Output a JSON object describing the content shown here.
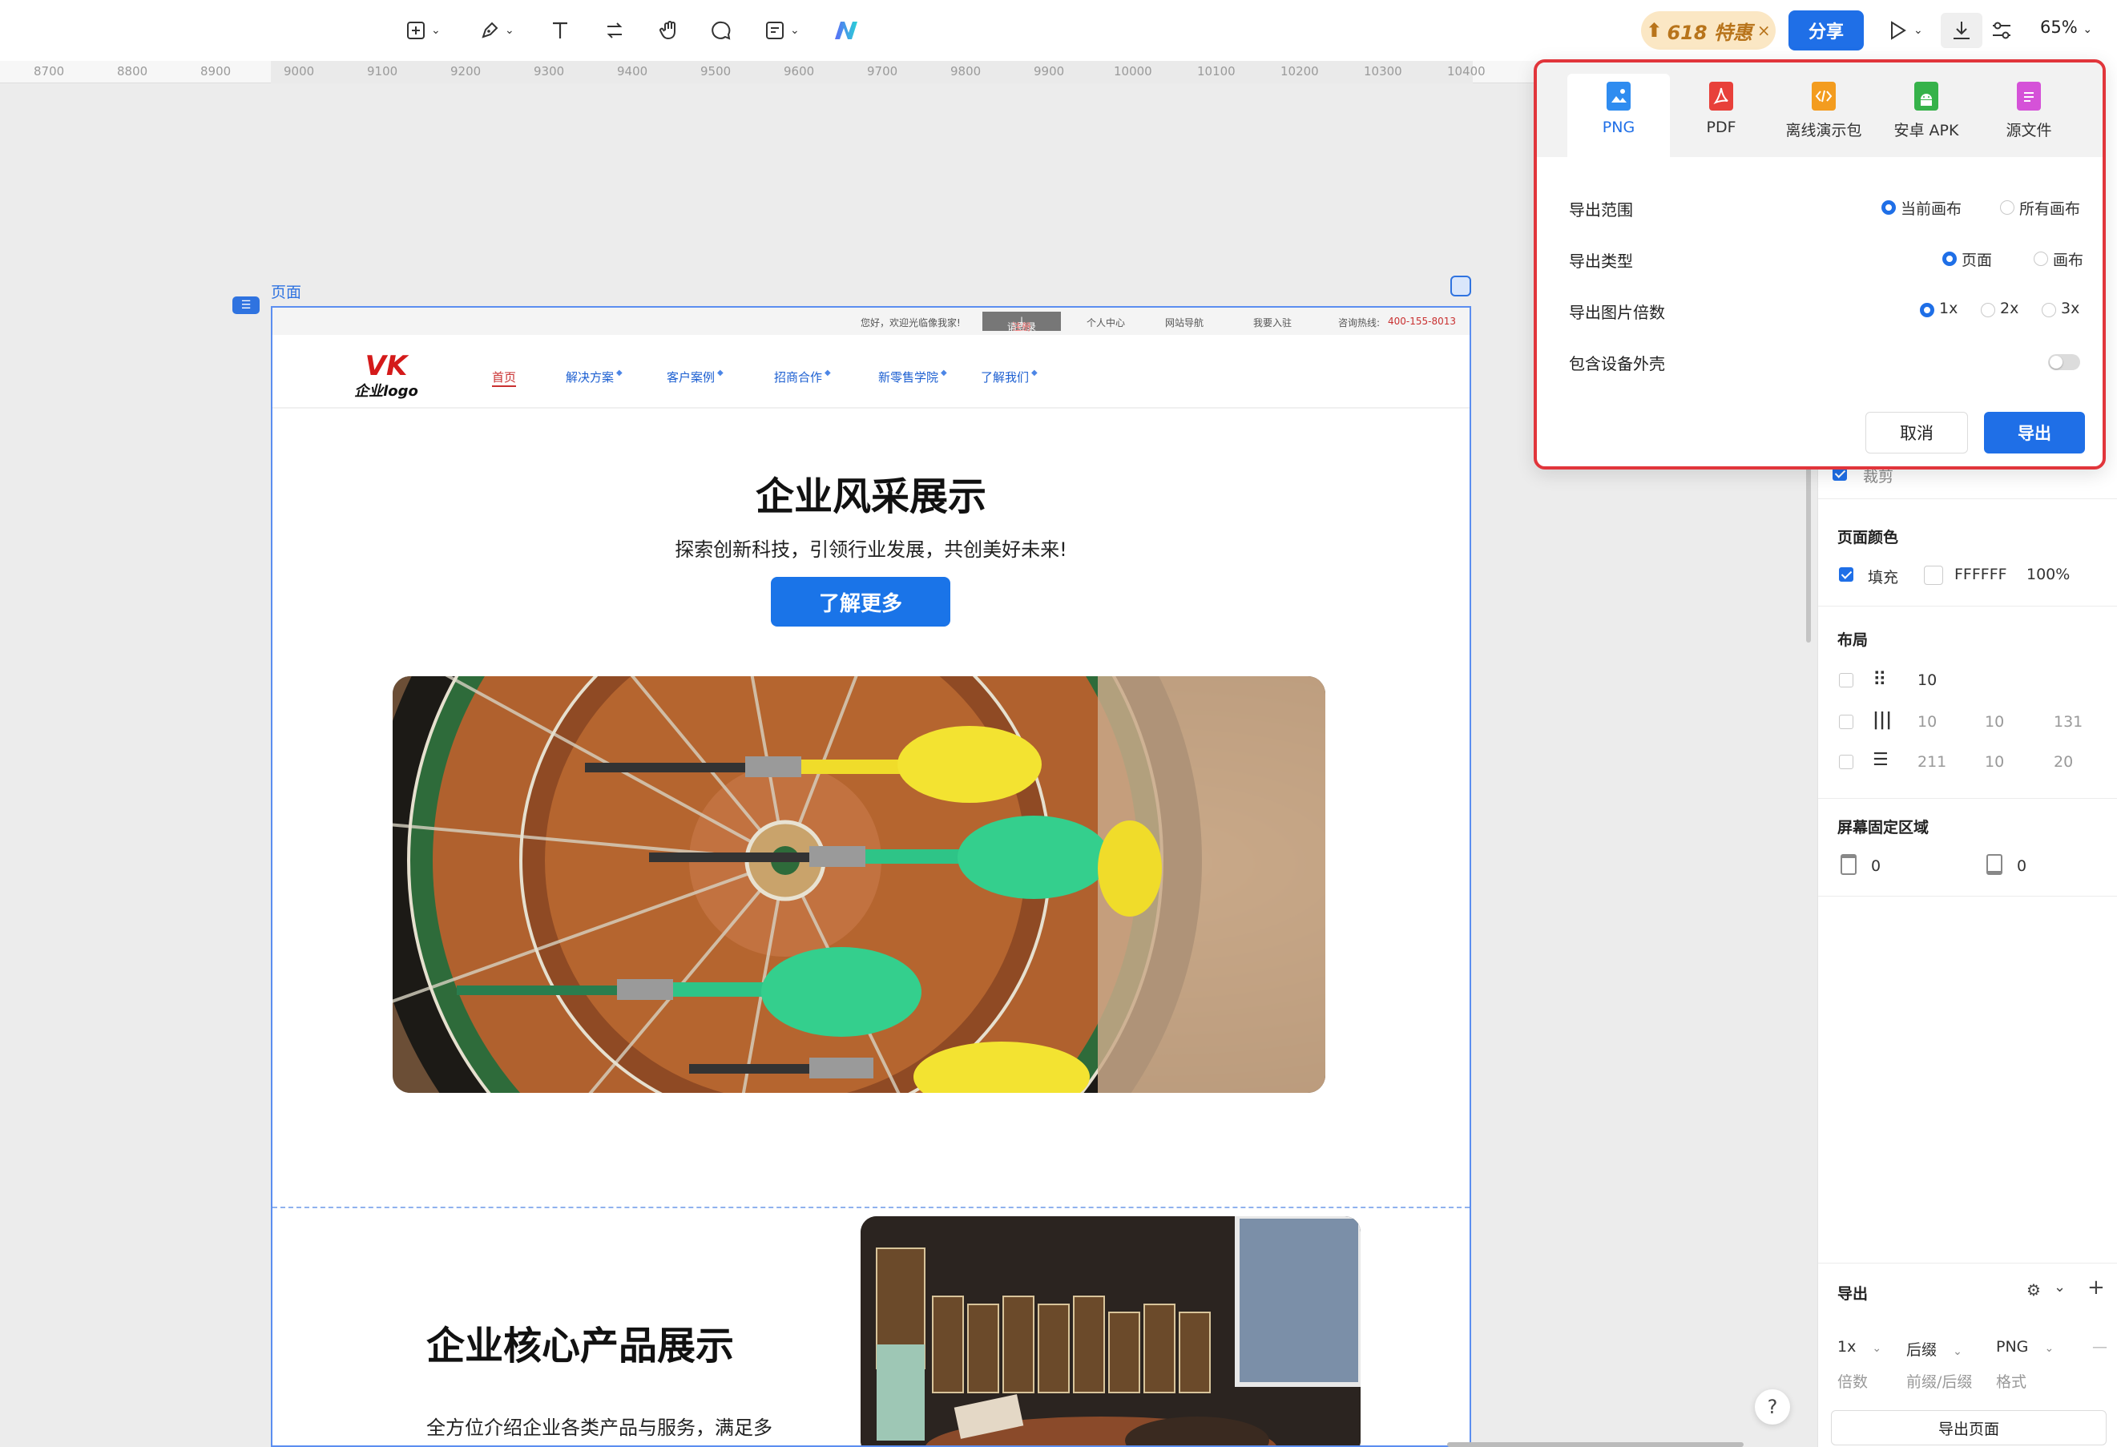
{
  "toolbar": {
    "promo_label": "618 特惠",
    "share_label": "分享",
    "zoom_label": "65%"
  },
  "ruler": {
    "ticks": [
      "8700",
      "8800",
      "8900",
      "9000",
      "9100",
      "9200",
      "9300",
      "9400",
      "9500",
      "9600",
      "9700",
      "9800",
      "9900",
      "10000",
      "10100",
      "10200",
      "10300",
      "10400"
    ]
  },
  "canvas": {
    "page_label": "页面"
  },
  "site": {
    "topbar": {
      "welcome": "您好，欢迎光临像我家!",
      "login": "请登录",
      "register": "注册",
      "personal": "个人中心",
      "site_nav": "网站导航",
      "join": "我要入驻",
      "hotline_label": "咨询热线:",
      "hotline": "400-155-8013"
    },
    "logo_mark": "VK",
    "logo_text": "企业logo",
    "nav": [
      {
        "label": "首页"
      },
      {
        "label": "解决方案"
      },
      {
        "label": "客户案例"
      },
      {
        "label": "招商合作"
      },
      {
        "label": "新零售学院"
      },
      {
        "label": "了解我们"
      }
    ],
    "hero_title": "企业风采展示",
    "hero_subtitle": "探索创新科技，引领行业发展，共创美好未来!",
    "hero_button": "了解更多",
    "section2_title": "企业核心产品展示",
    "section2_text": "全方位介绍企业各类产品与服务，满足多"
  },
  "export_dialog": {
    "tabs": [
      {
        "label": "PNG",
        "color": "#2f8cf0"
      },
      {
        "label": "PDF",
        "color": "#e8403a"
      },
      {
        "label": "离线演示包",
        "color": "#f39c1f"
      },
      {
        "label": "安卓 APK",
        "color": "#36b24a"
      },
      {
        "label": "源文件",
        "color": "#d552d8"
      }
    ],
    "range_label": "导出范围",
    "range_options": [
      "当前画布",
      "所有画布"
    ],
    "type_label": "导出类型",
    "type_options": [
      "页面",
      "画布"
    ],
    "scale_label": "导出图片倍数",
    "scale_options": [
      "1x",
      "2x",
      "3x"
    ],
    "device_label": "包含设备外壳",
    "cancel_label": "取消",
    "export_label": "导出"
  },
  "panel": {
    "crop_label": "裁剪",
    "page_color_title": "页面颜色",
    "fill_label": "填充",
    "fill_hex": "FFFFFF",
    "fill_opacity": "100%",
    "layout_title": "布局",
    "grid_value": "10",
    "columns_values": [
      "10",
      "10",
      "131"
    ],
    "rows_values": [
      "211",
      "10",
      "20"
    ],
    "fixed_area_title": "屏幕固定区域",
    "fixed_top": "0",
    "fixed_bottom": "0",
    "export_title": "导出",
    "export_scale": "1x",
    "export_suffix": "后缀",
    "export_format": "PNG",
    "export_scale_caption": "倍数",
    "export_suffix_caption": "前缀/后缀",
    "export_format_caption": "格式",
    "export_page_button": "导出页面"
  },
  "help_label": "?"
}
